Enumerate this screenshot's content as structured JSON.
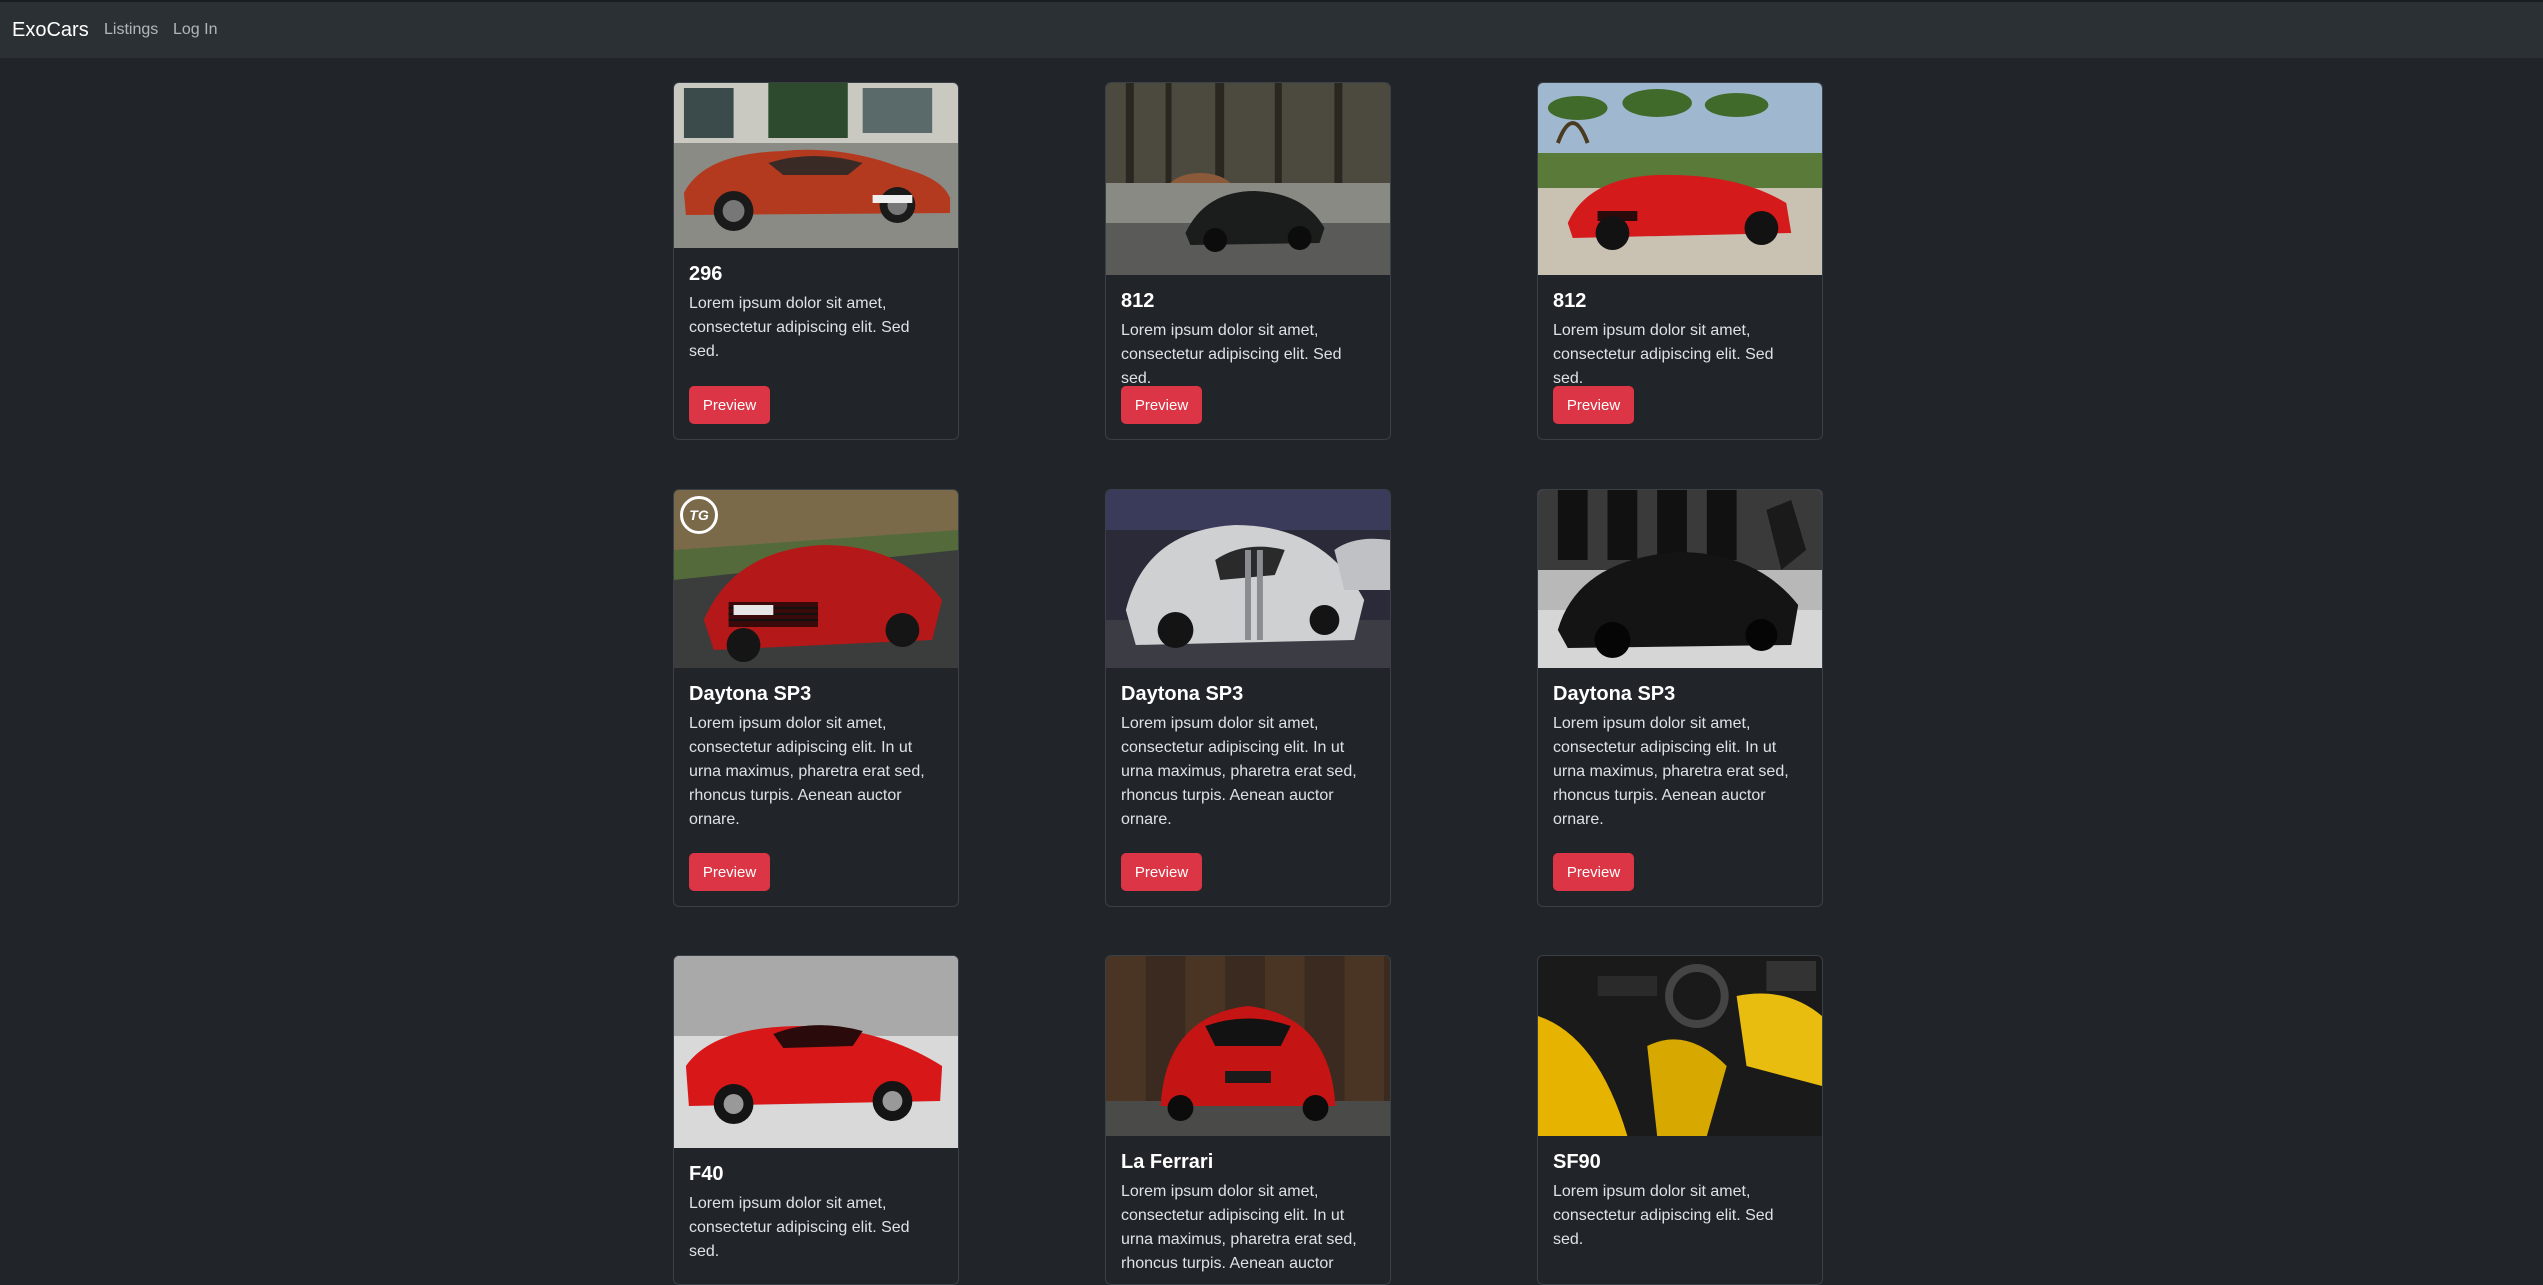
{
  "navbar": {
    "brand": "ExoCars",
    "links": [
      {
        "label": "Listings"
      },
      {
        "label": "Log In"
      }
    ]
  },
  "listings": [
    {
      "title": "296",
      "text": "Lorem ipsum dolor sit amet, consectetur adipiscing elit. Sed sed.",
      "button": "Preview"
    },
    {
      "title": "812",
      "text": "Lorem ipsum dolor sit amet, consectetur adipiscing elit. Sed sed.",
      "button": "Preview"
    },
    {
      "title": "812",
      "text": "Lorem ipsum dolor sit amet, consectetur adipiscing elit. Sed sed.",
      "button": "Preview"
    },
    {
      "title": "Daytona SP3",
      "text": "Lorem ipsum dolor sit amet, consectetur adipiscing elit. In ut urna maximus, pharetra erat sed, rhoncus turpis. Aenean auctor ornare.",
      "button": "Preview",
      "photo_logo": "TG"
    },
    {
      "title": "Daytona SP3",
      "text": "Lorem ipsum dolor sit amet, consectetur adipiscing elit. In ut urna maximus, pharetra erat sed, rhoncus turpis. Aenean auctor ornare.",
      "button": "Preview"
    },
    {
      "title": "Daytona SP3",
      "text": "Lorem ipsum dolor sit amet, consectetur adipiscing elit. In ut urna maximus, pharetra erat sed, rhoncus turpis. Aenean auctor ornare.",
      "button": "Preview"
    },
    {
      "title": "F40",
      "text": "Lorem ipsum dolor sit amet, consectetur adipiscing elit. Sed sed."
    },
    {
      "title": "La Ferrari",
      "text": "Lorem ipsum dolor sit amet, consectetur adipiscing elit. In ut urna maximus, pharetra erat sed, rhoncus turpis. Aenean auctor"
    },
    {
      "title": "SF90",
      "text": "Lorem ipsum dolor sit amet, consectetur adipiscing elit. Sed sed."
    }
  ],
  "colors": {
    "page_background": "#212529",
    "navbar_background": "#2b3035",
    "button_red": "#dc3545"
  }
}
